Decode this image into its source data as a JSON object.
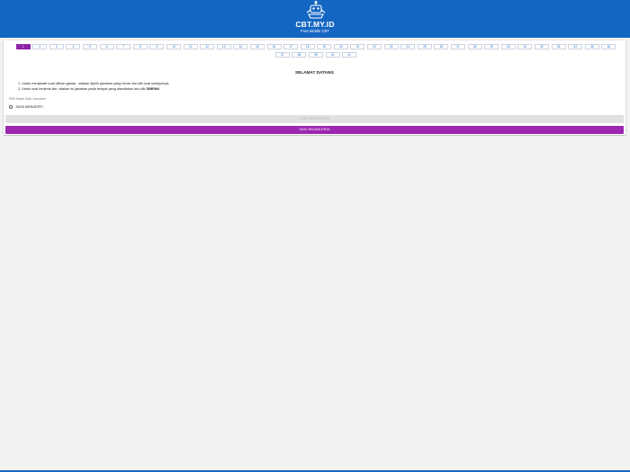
{
  "header": {
    "logo_icon": "robot-mascot-icon",
    "title": "CBT.MY.ID",
    "subtitle": "Free Mobile CBT",
    "background_color": "#1466c3"
  },
  "question_nav": {
    "active": "1",
    "active_color": "#8e24aa",
    "items": [
      "1",
      "2",
      "3",
      "4",
      "5",
      "6",
      "7",
      "8",
      "9",
      "10",
      "11",
      "12",
      "13",
      "14",
      "15",
      "16",
      "17",
      "18",
      "19",
      "20",
      "21",
      "22",
      "23",
      "24",
      "25",
      "26",
      "27",
      "28",
      "29",
      "30",
      "31",
      "32",
      "33",
      "34",
      "35",
      "36",
      "37",
      "38",
      "39",
      "40",
      "41"
    ]
  },
  "main": {
    "welcome_title": "SELAMAT DATANG",
    "instructions": [
      "1. Untuk menjawab soal pilihan ganda , silakan dipilih jawaban yang benar dan klik soal selanjutnya.",
      "2. Untuk soal berjenis lain, silakan isi jawaban pada tempat yang disediakan lalu klik"
    ],
    "instruction_bold_word": "SIMPAN",
    "prompt": "Pilih Salah Satu Jawaban",
    "options": [
      "SAYA MENGERTI"
    ]
  },
  "buttons": {
    "save_label": "SOAL SEBELUMNYA",
    "next_label": "SOAL SELANJUTNYA",
    "next_color": "#9c27b0"
  }
}
